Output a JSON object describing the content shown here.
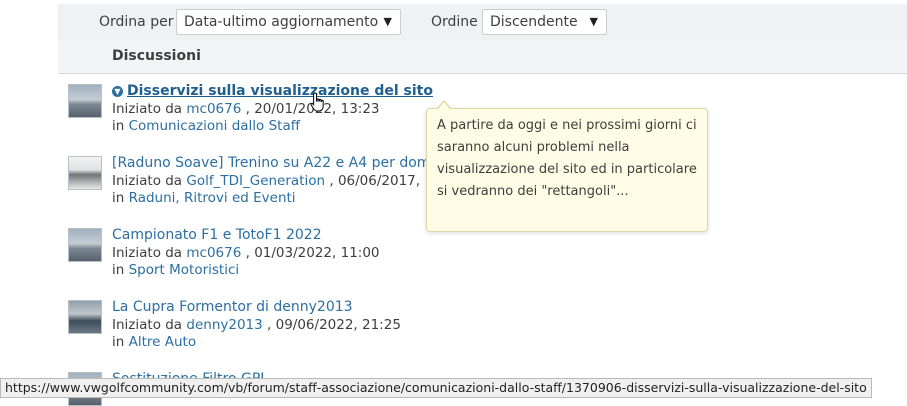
{
  "sort": {
    "order_by_label": "Ordina per",
    "order_by_value": "Data-ultimo aggiornamento",
    "order_label": "Ordine",
    "order_value": "Discendente"
  },
  "header": {
    "title": "Discussioni"
  },
  "threads": [
    {
      "title": "Disservizi sulla visualizzazione del sito",
      "started_by_prefix": "Iniziato da",
      "author": "mc0676",
      "date": ", 20/01/2022, 13:23",
      "in_prefix": "in",
      "forum": "Comunicazioni dallo Staff"
    },
    {
      "title": "[Raduno Soave] Trenino su A22 e A4 per dom",
      "started_by_prefix": "Iniziato da",
      "author": "Golf_TDI_Generation",
      "date": ", 06/06/2017,",
      "in_prefix": "in",
      "forum": "Raduni, Ritrovi ed Eventi"
    },
    {
      "title": "Campionato F1 e TotoF1 2022",
      "started_by_prefix": "Iniziato da",
      "author": "mc0676",
      "date": ", 01/03/2022, 11:00",
      "in_prefix": "in",
      "forum": "Sport Motoristici"
    },
    {
      "title": "La Cupra Formentor di denny2013",
      "started_by_prefix": "Iniziato da",
      "author": "denny2013",
      "date": ", 09/06/2022, 21:25",
      "in_prefix": "in",
      "forum": "Altre Auto"
    },
    {
      "title": "Sostituzione Filtro GPL"
    }
  ],
  "tooltip": {
    "text": "A partire da oggi e nei prossimi giorni ci saranno alcuni problemi nella visualizzazione del sito ed in particolare si vedranno dei \"rettangoli\"..."
  },
  "status_url": "https://www.vwgolfcommunity.com/vb/forum/staff-associazione/comunicazioni-dallo-staff/1370906-disservizi-sulla-visualizzazione-del-sito"
}
